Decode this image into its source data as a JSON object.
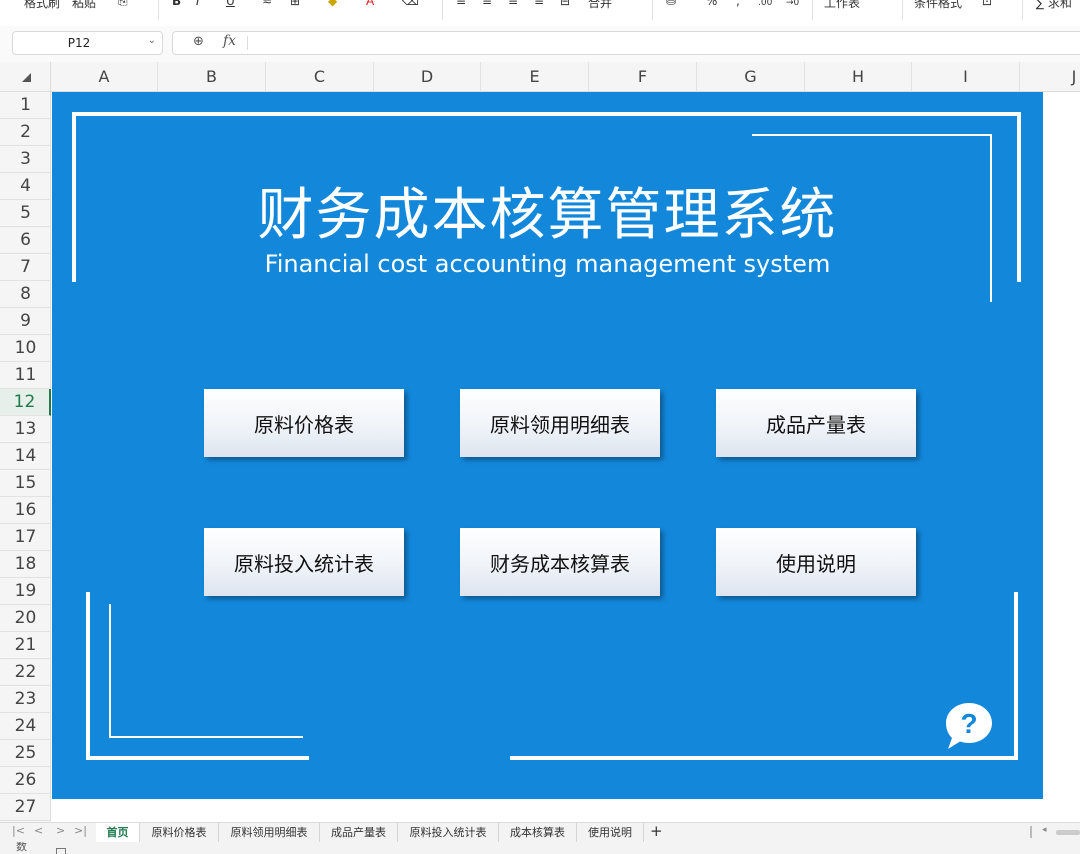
{
  "ribbon": {
    "items": [
      "格式刷",
      "粘贴",
      "B",
      "I",
      "U",
      "A",
      "合并",
      "%",
      "工作表",
      "条件格式",
      "求和"
    ]
  },
  "formula_bar": {
    "cell_ref": "P12",
    "fx": "fx"
  },
  "columns": [
    "A",
    "B",
    "C",
    "D",
    "E",
    "F",
    "G",
    "H",
    "I",
    "J"
  ],
  "rows": [
    "1",
    "2",
    "3",
    "4",
    "5",
    "6",
    "7",
    "8",
    "9",
    "10",
    "11",
    "12",
    "13",
    "14",
    "15",
    "16",
    "17",
    "18",
    "19",
    "20",
    "21",
    "22",
    "23",
    "24",
    "25",
    "26",
    "27"
  ],
  "selected_row": "12",
  "dashboard": {
    "title": "财务成本核算管理系统",
    "subtitle": "Financial cost accounting management system",
    "buttons": [
      "原料价格表",
      "原料领用明细表",
      "成品产量表",
      "原料投入统计表",
      "财务成本核算表",
      "使用说明"
    ],
    "help_glyph": "?",
    "background_color": "#1388db"
  },
  "tabs": {
    "names": [
      "首页",
      "原料价格表",
      "原料领用明细表",
      "成品产量表",
      "原料投入统计表",
      "成本核算表",
      "使用说明"
    ],
    "active": "首页",
    "add": "+"
  },
  "statusbar": {
    "text": "数"
  }
}
